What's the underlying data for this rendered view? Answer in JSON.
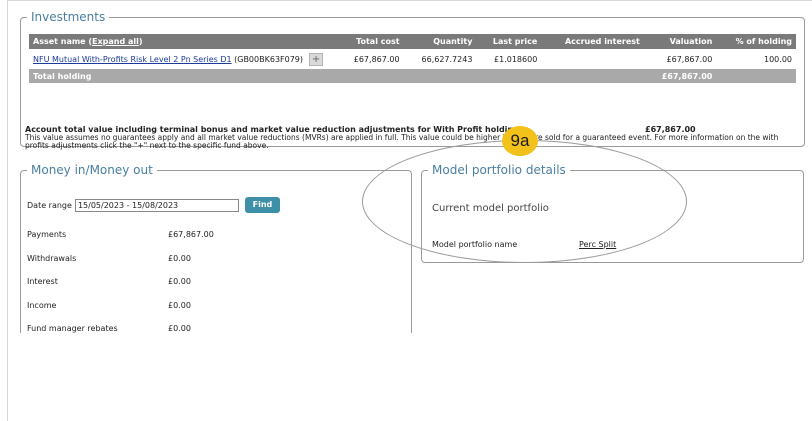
{
  "investments": {
    "legend": "Investments",
    "headers": {
      "asset_prefix": "Asset name (",
      "expand_all": "Expand all",
      "asset_suffix": ")",
      "total_cost": "Total cost",
      "quantity": "Quantity",
      "last_price": "Last price",
      "accrued_interest": "Accrued interest",
      "valuation": "Valuation",
      "pct_holding": "% of holding"
    },
    "row": {
      "fund_name": "NFU Mutual With-Profits Risk Level 2 Pn Series D1",
      "fund_code": "(GB00BK63F079)",
      "plus": "+",
      "total_cost": "£67,867.00",
      "quantity": "66,627.7243",
      "last_price": "£1.018600",
      "accrued_interest": "",
      "valuation": "£67,867.00",
      "pct_holding": "100.00"
    },
    "total": {
      "label": "Total holding",
      "valuation": "£67,867.00"
    },
    "account_total": {
      "label": "Account total value including terminal bonus and market value reduction adjustments for With Profit holdings.",
      "value": "£67,867.00",
      "note": "This value assumes no guarantees apply and all market value reductions (MVRs) are applied in full. This value could be higher if units are sold for a guaranteed event. For more information on the with profits adjustments click the \"+\" next to the specific fund above."
    }
  },
  "money": {
    "legend": "Money in/Money out",
    "date_label": "Date range",
    "date_value": "15/05/2023 - 15/08/2023",
    "find_label": "Find",
    "rows": [
      {
        "label": "Payments",
        "value": "£67,867.00"
      },
      {
        "label": "Withdrawals",
        "value": "£0.00"
      },
      {
        "label": "Interest",
        "value": "£0.00"
      },
      {
        "label": "Income",
        "value": "£0.00"
      },
      {
        "label": "Fund manager rebates",
        "value": "£0.00"
      }
    ]
  },
  "model": {
    "legend": "Model portfolio details",
    "current": "Current model portfolio",
    "name_label": "Model portfolio name",
    "name_value": "Perc Split"
  },
  "annotation": {
    "badge": "9a",
    "color": "#f2c11a"
  }
}
